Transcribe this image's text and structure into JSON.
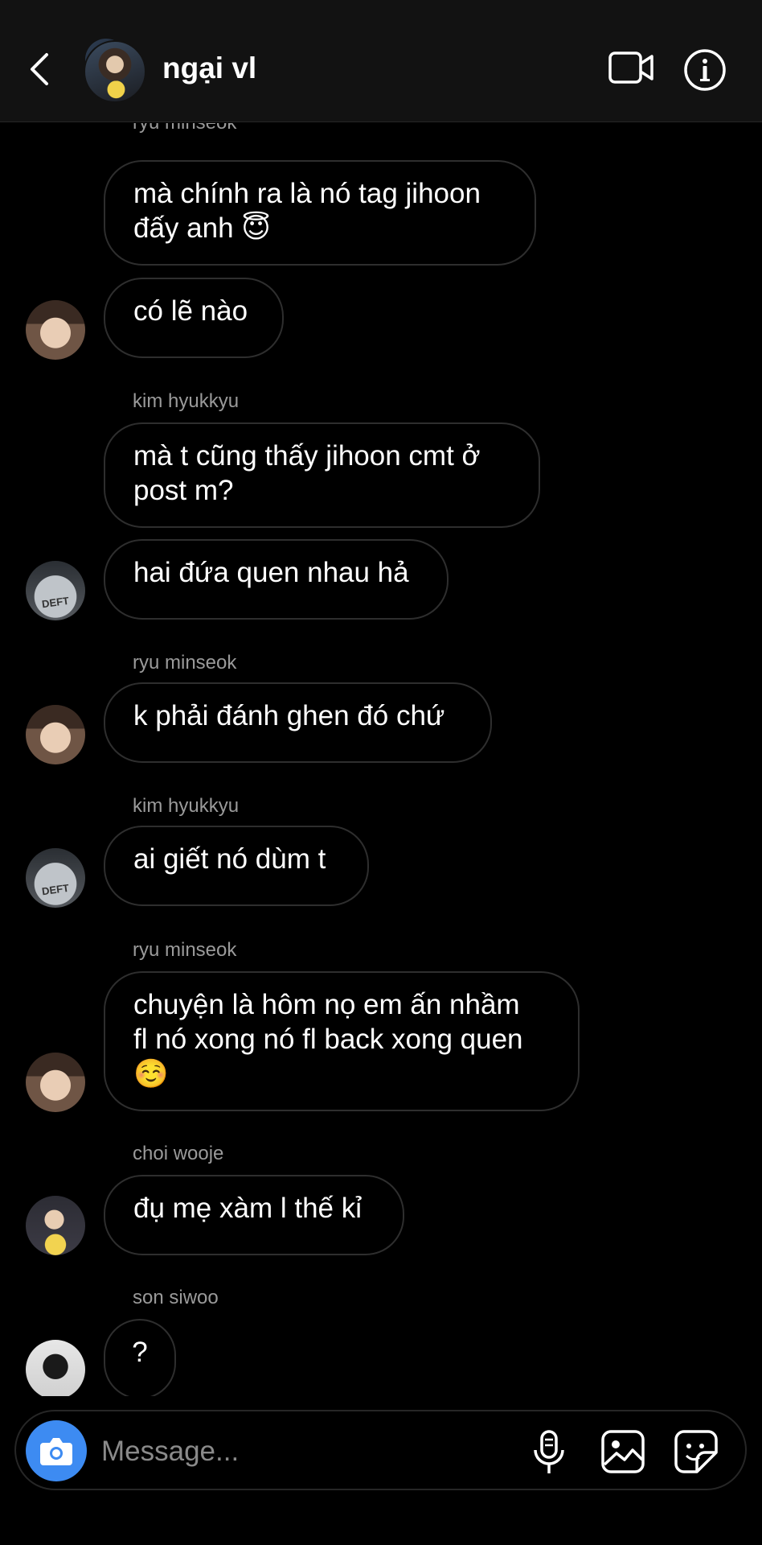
{
  "header": {
    "title": "ngại vl",
    "icons": {
      "back": "chevron-left-icon",
      "video": "video-call-icon",
      "info": "info-icon"
    }
  },
  "messages": [
    {
      "sender": "ryu minseok",
      "text": "mà chính ra là nó tag jihoon\nđấy anh 😇",
      "avatar": "ryu"
    },
    {
      "sender": "",
      "text": "có lẽ nào",
      "avatar": "ryu"
    },
    {
      "sender": "kim hyukkyu",
      "text": "mà t cũng thấy jihoon cmt ở\npost m?",
      "avatar": "kim"
    },
    {
      "sender": "",
      "text": "hai đứa quen nhau hả",
      "avatar": "kim"
    },
    {
      "sender": "ryu minseok",
      "text": "k phải đánh ghen đó chứ",
      "avatar": "ryu"
    },
    {
      "sender": "kim hyukkyu",
      "text": "ai giết nó dùm t",
      "avatar": "kim"
    },
    {
      "sender": "ryu minseok",
      "text": "chuyện là hôm nọ em ấn nhầm\nfl nó xong nó fl back xong quen\n☺️",
      "avatar": "ryu"
    },
    {
      "sender": "choi wooje",
      "text": "đụ mẹ xàm l thế kỉ",
      "avatar": "choi"
    },
    {
      "sender": "son siwoo",
      "text": "?",
      "avatar": "son"
    }
  ],
  "avatar_labels": {
    "kim": "DEFT"
  },
  "composer": {
    "placeholder": "Message...",
    "icons": {
      "camera": "camera-icon",
      "mic": "microphone-icon",
      "gallery": "gallery-icon",
      "sticker": "sticker-icon"
    }
  },
  "colors": {
    "background": "#000000",
    "header": "#121212",
    "bubble_border": "#2e2e2e",
    "camera_button": "#3d8bf2",
    "sender": "#9a9a9a"
  }
}
